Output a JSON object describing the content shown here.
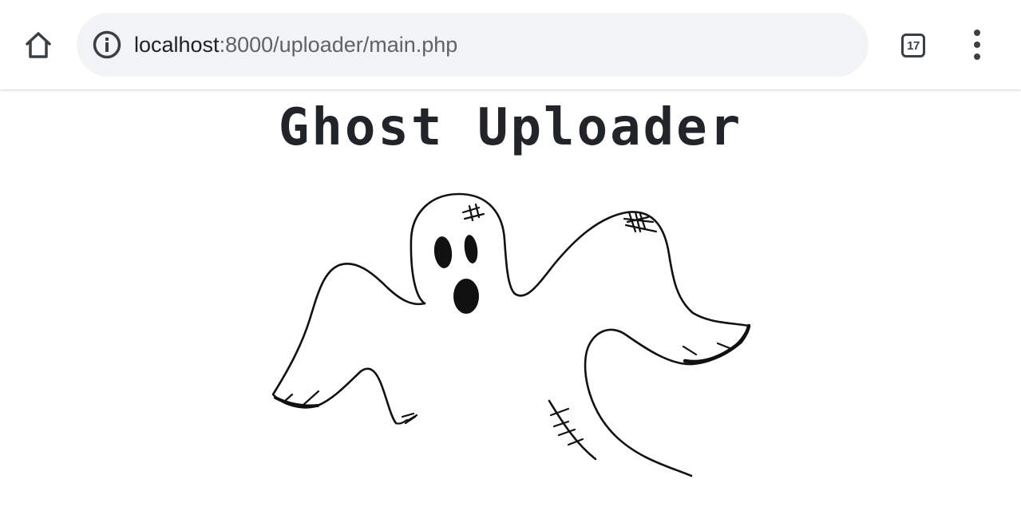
{
  "browser": {
    "url_host": "localhost",
    "url_path": ":8000/uploader/main.php",
    "tab_count": "17",
    "icons": {
      "home": "home-icon",
      "info": "info-icon",
      "tabs": "tab-switcher-icon",
      "menu": "more-vert-icon"
    }
  },
  "page": {
    "title": "Ghost Uploader",
    "illustration": "ghost-illustration"
  }
}
